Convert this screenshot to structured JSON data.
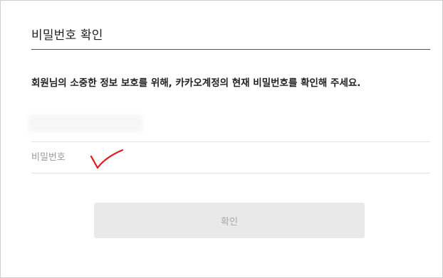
{
  "dialog": {
    "title": "비밀번호 확인",
    "description": "회원님의 소중한 정보 보호를 위해, 카카오계정의 현재 비밀번호를 확인해 주세요."
  },
  "account": {
    "value": ""
  },
  "password": {
    "placeholder": "비밀번호",
    "value": ""
  },
  "confirm_button": {
    "label": "확인",
    "enabled": false
  },
  "colors": {
    "annotation_mark": "#e01a1a",
    "button_background": "#e9e9e9",
    "button_text": "#a9a9a9"
  },
  "icons": {
    "annotation": "red-checkmark-icon"
  }
}
